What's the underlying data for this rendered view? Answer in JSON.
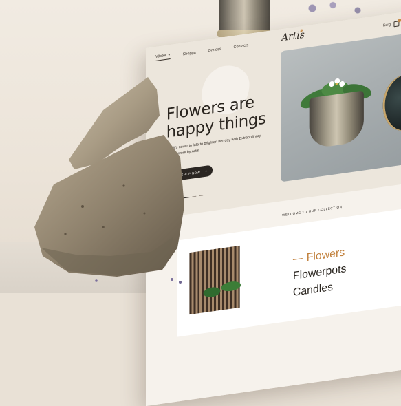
{
  "nav": {
    "items": [
      {
        "label": "Växter",
        "has_dropdown": true,
        "active": true
      },
      {
        "label": "Shoppa",
        "has_dropdown": false,
        "active": false
      },
      {
        "label": "Om oss",
        "has_dropdown": false,
        "active": false
      },
      {
        "label": "Contacts",
        "has_dropdown": false,
        "active": false
      }
    ],
    "logo": "Artis",
    "cart_label": "Korg"
  },
  "hero": {
    "title_line1": "Flowers are",
    "title_line2": "happy things",
    "subtitle": "It's never to late to brighten her day with Extraordinary Flowers by Artis.",
    "cta_label": "SHOP NOW",
    "slides_total": 3,
    "slide_active": 1
  },
  "collection": {
    "kicker": "WELCOME TO OUR COLLECTION",
    "categories": [
      {
        "label": "Flowers",
        "active": true
      },
      {
        "label": "Flowerpots",
        "active": false
      },
      {
        "label": "Candles",
        "active": false
      }
    ]
  },
  "colors": {
    "accent": "#c17f3a",
    "dark": "#2b2622",
    "hero_bg": "#ece6dc"
  },
  "icons": {
    "cta_arrow": "arrow-right-icon",
    "cart": "bag-icon",
    "dropdown": "chevron-down-icon"
  }
}
